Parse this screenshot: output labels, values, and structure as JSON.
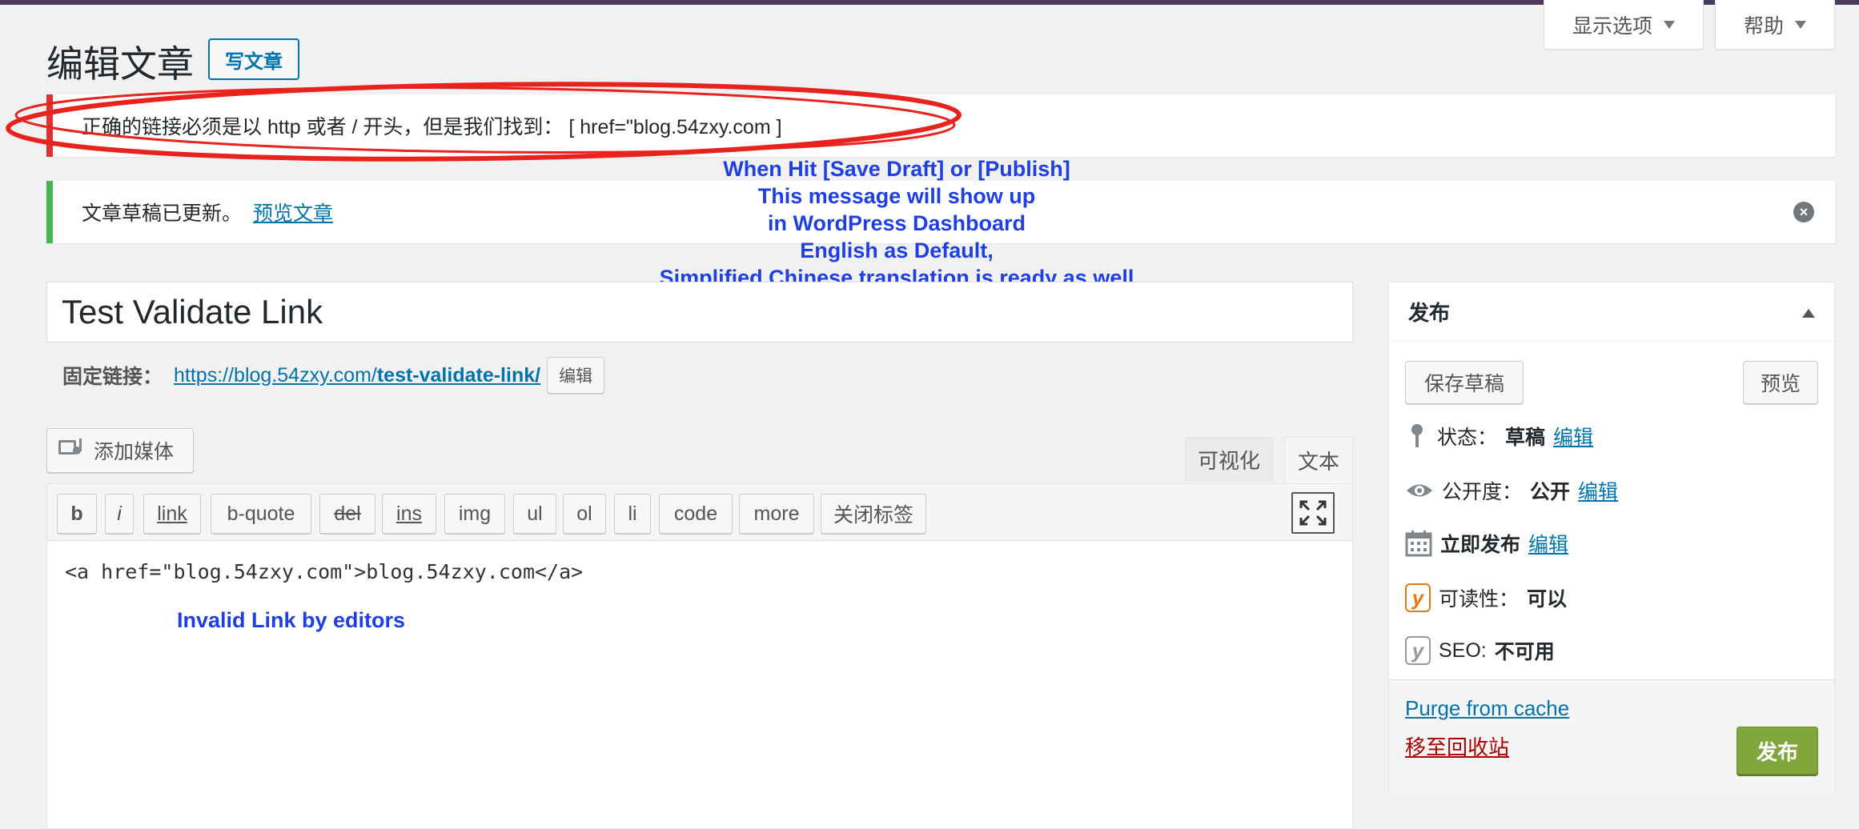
{
  "screen_options": {
    "label": "显示选项",
    "help_label": "帮助"
  },
  "header": {
    "title": "编辑文章",
    "new_post_button": "写文章"
  },
  "notices": {
    "error_text": "正确的链接必须是以 http 或者 / 开头，但是我们找到：  [ href=\"blog.54zxy.com ]",
    "success_text": "文章草稿已更新。",
    "success_link": "预览文章"
  },
  "annotations": {
    "top_lines": [
      "When Hit [Save Draft] or [Publish]",
      "This message will show up",
      "in WordPress Dashboard",
      "English as Default,",
      "Simplified Chinese translation is ready as well"
    ],
    "editor_note": "Invalid Link by editors",
    "highlight_color": "#e8231d",
    "note_color": "#1f3fe0"
  },
  "post": {
    "title": "Test Validate Link",
    "permalink_label": "固定链接：",
    "permalink_base": "https://blog.54zxy.com/",
    "permalink_slug": "test-validate-link/",
    "permalink_edit": "编辑",
    "content": "<a href=\"blog.54zxy.com\">blog.54zxy.com</a>"
  },
  "editor": {
    "add_media": "添加媒体",
    "tab_visual": "可视化",
    "tab_text": "文本",
    "quicktags": [
      "b",
      "i",
      "link",
      "b-quote",
      "del",
      "ins",
      "img",
      "ul",
      "ol",
      "li",
      "code",
      "more",
      "关闭标签"
    ]
  },
  "publish": {
    "title": "发布",
    "save_draft": "保存草稿",
    "preview": "预览",
    "status_label": "状态：",
    "status_value": "草稿",
    "visibility_label": "公开度：",
    "visibility_value": "公开",
    "schedule_label": "立即发布",
    "edit": "编辑",
    "readability_label": "可读性：",
    "readability_value": "可以",
    "seo_label": "SEO:",
    "seo_value": "不可用",
    "purge": "Purge from cache",
    "trash": "移至回收站",
    "publish_button": "发布"
  },
  "colors": {
    "accent": "#0073aa",
    "error": "#dc3232",
    "success": "#46b450",
    "publish": "#81a73c"
  }
}
